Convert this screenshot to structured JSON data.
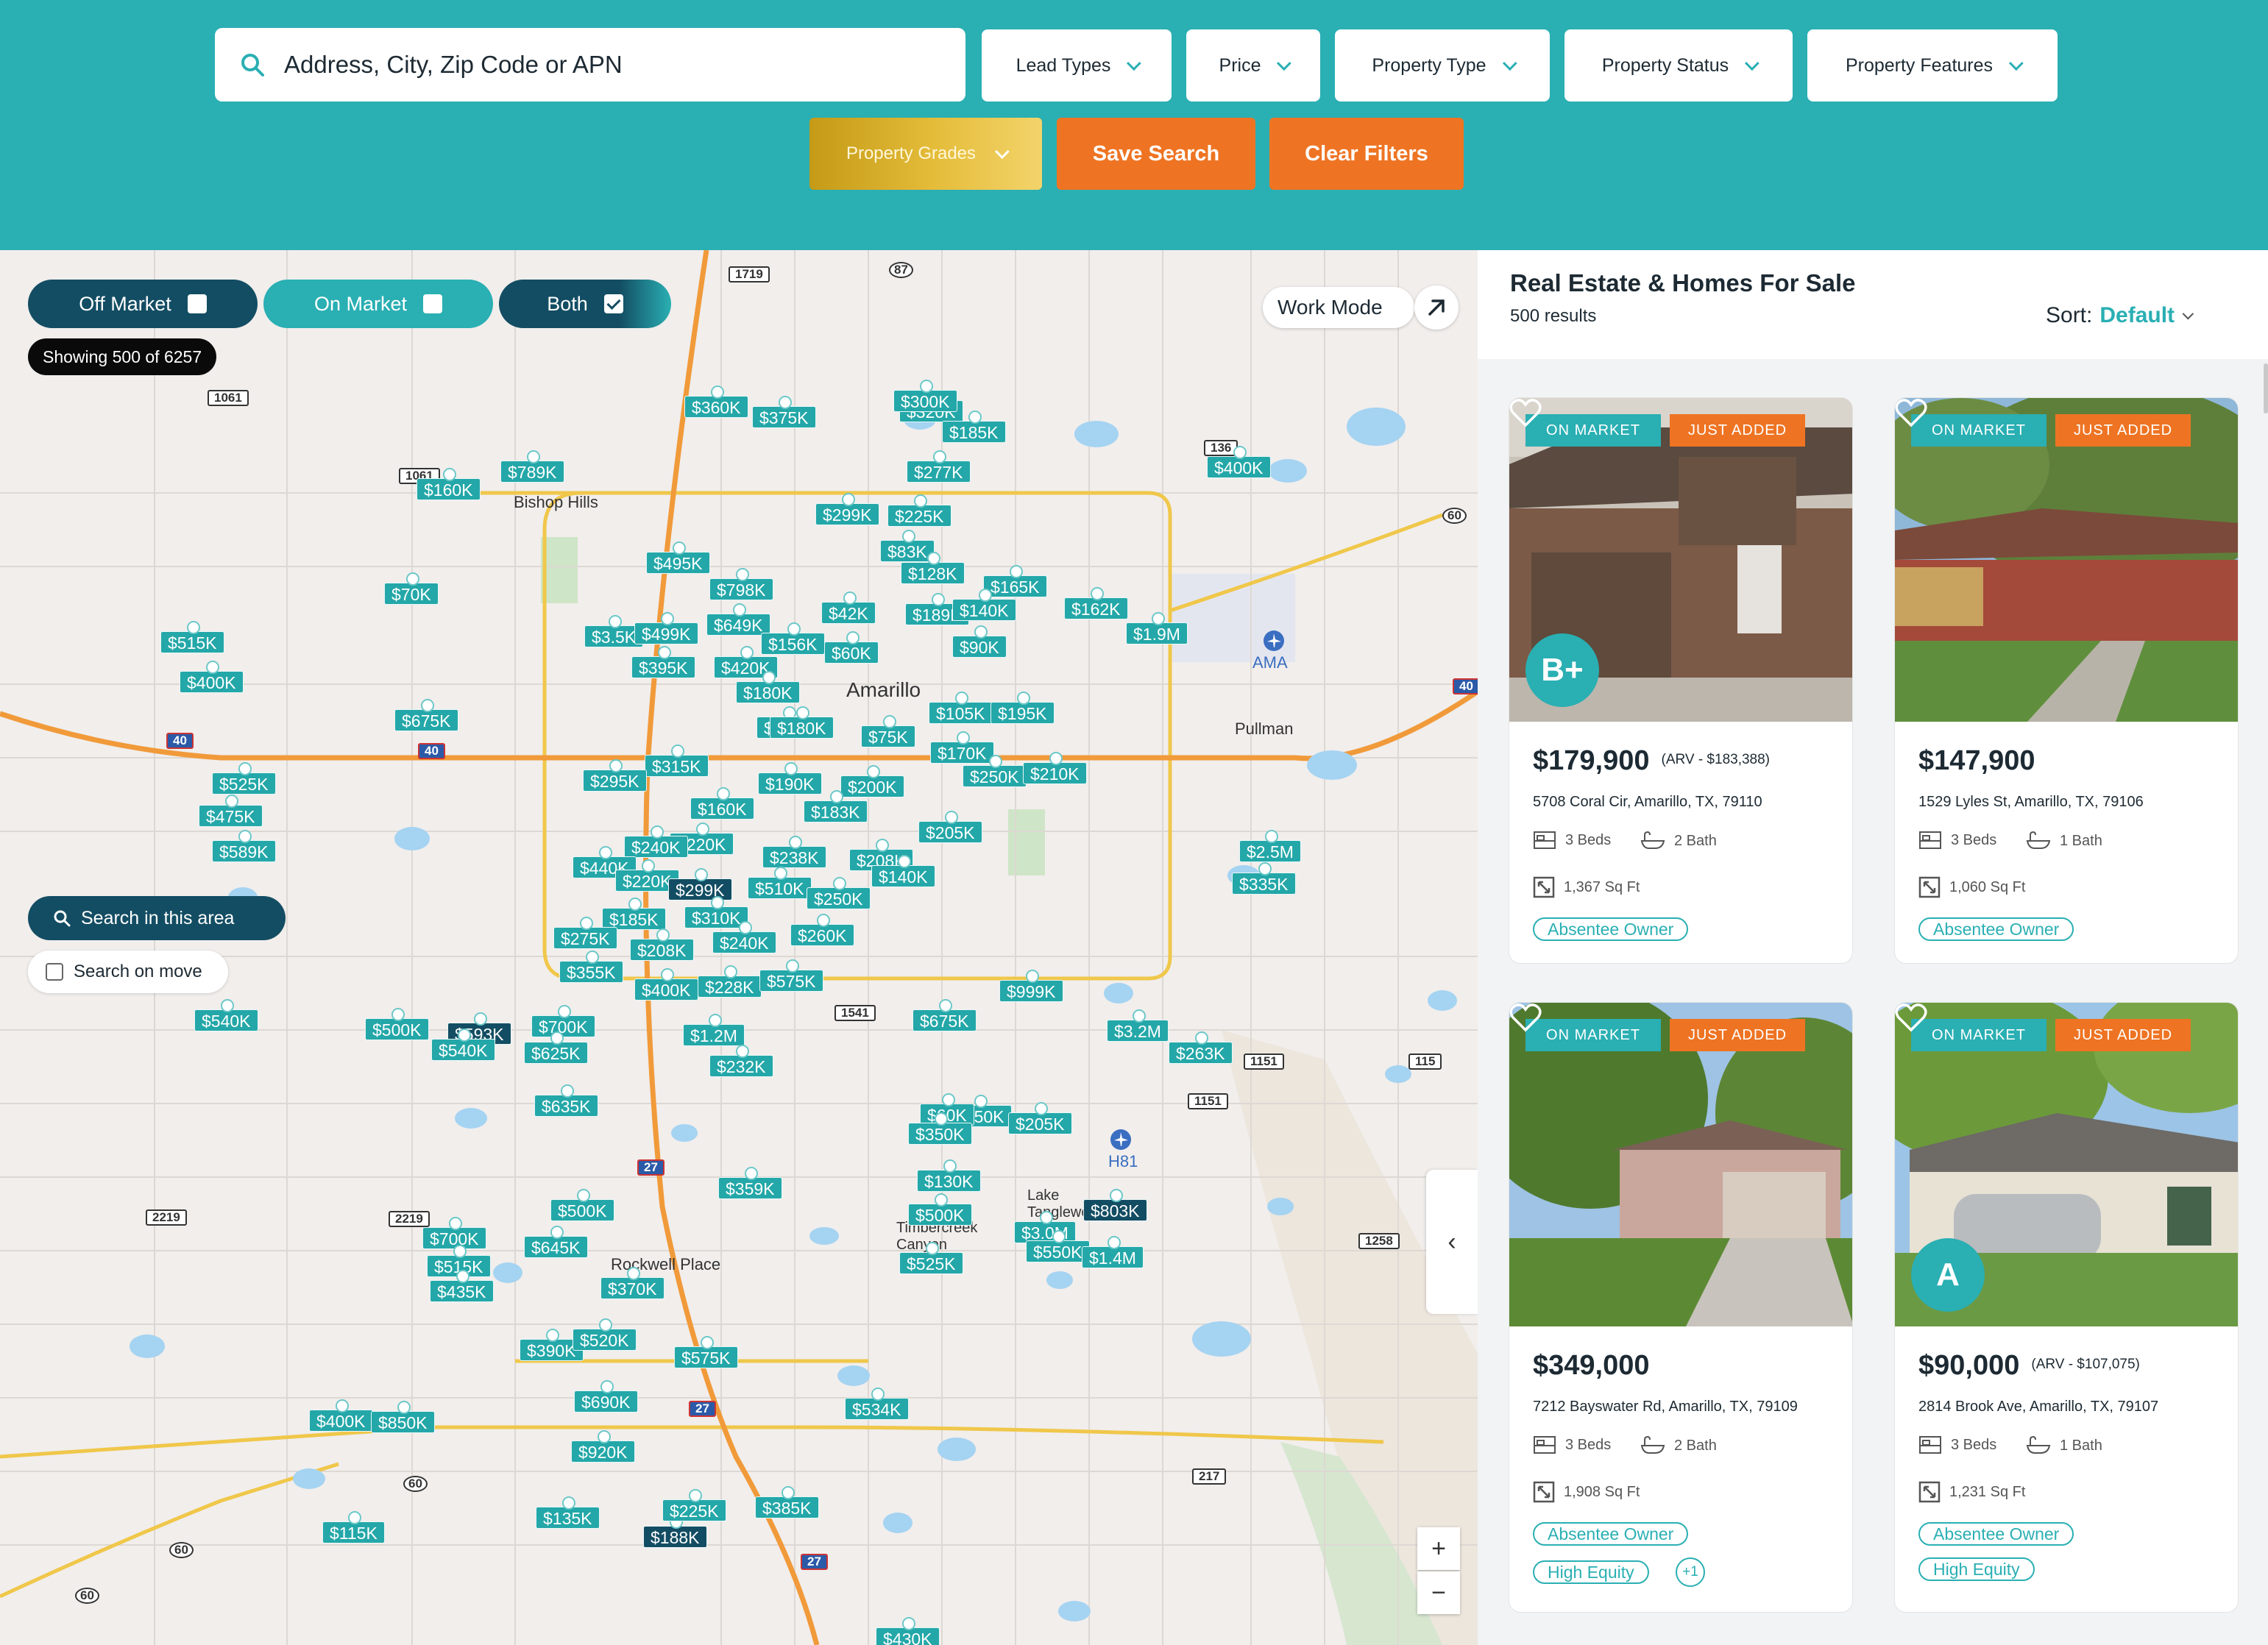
{
  "search": {
    "placeholder": "Address, City, Zip Code or APN"
  },
  "filters": {
    "lead_types": "Lead Types",
    "price": "Price",
    "property_type": "Property Type",
    "property_status": "Property Status",
    "property_features": "Property Features",
    "property_grades": "Property Grades",
    "save_search": "Save Search",
    "clear_filters": "Clear Filters"
  },
  "map": {
    "toggle_off": "Off Market",
    "toggle_on": "On Market",
    "toggle_both": "Both",
    "showing": "Showing 500 of 6257",
    "work_mode": "Work Mode",
    "search_area": "Search in this area",
    "search_move": "Search on move",
    "zoom_in": "+",
    "zoom_out": "−",
    "places": [
      "Bishop Hills",
      "Amarillo",
      "Pullman",
      "AMA",
      "H81",
      "Rockwell Place",
      "Lake Tanglewood",
      "Timbercreek Canyon"
    ],
    "shields": [
      "1719",
      "87",
      "1061",
      "1061",
      "136",
      "60",
      "40",
      "40",
      "40",
      "1541",
      "1151",
      "1151",
      "115",
      "2219",
      "2219",
      "27",
      "1258",
      "27",
      "60",
      "217",
      "60",
      "60",
      "27"
    ],
    "prices": [
      "$360K",
      "$375K",
      "$320K",
      "$185K",
      "$789K",
      "$160K",
      "$277K",
      "$299K",
      "$225K",
      "$400K",
      "$495K",
      "$798K",
      "$83K",
      "$128K",
      "$165K",
      "$70K",
      "$162K",
      "$1.9M",
      "$515K",
      "$400K",
      "$3.5K",
      "$499K",
      "$649K",
      "$42K",
      "$189K",
      "$140K",
      "$395K",
      "$420K",
      "$156K",
      "$60K",
      "$90K",
      "$180K",
      "$105K",
      "$195K",
      "$675K",
      "$184K",
      "$75K",
      "$315K",
      "$295K",
      "$525K",
      "$475K",
      "$170K",
      "$250K",
      "$210K",
      "$190K",
      "$160K",
      "$200K",
      "$183K",
      "$589K",
      "$220K",
      "$240K",
      "$238K",
      "$208K",
      "$205K",
      "$2.5M",
      "$335K",
      "$440K",
      "$220K",
      "$299K",
      "$510K",
      "$140K",
      "$250K",
      "$185K",
      "$310K",
      "$275K",
      "$240K",
      "$260K",
      "$208K",
      "$355K",
      "$228K",
      "$575K",
      "$400K",
      "$540K",
      "$999K",
      "$675K",
      "$500K",
      "$593K",
      "$700K",
      "$540K",
      "$625K",
      "$1.2M",
      "$3.2M",
      "$263K",
      "$232K",
      "$635K",
      "$350K",
      "$205K",
      "$60K",
      "$359K",
      "$130K",
      "$803K",
      "$500K",
      "$3.0M",
      "$550K",
      "$1.4M",
      "$700K",
      "$645K",
      "$515K",
      "$435K",
      "$525K",
      "$370K",
      "$390K",
      "$520K",
      "$575K",
      "$690K",
      "$400K",
      "$850K",
      "$534K",
      "$920K",
      "$115K",
      "$135K",
      "$385K",
      "$188K",
      "$430K",
      "$225K",
      "$350K",
      "$300K",
      "$500K",
      "$180K"
    ]
  },
  "panel": {
    "title": "Real Estate & Homes For Sale",
    "count": "500 results",
    "sort_label": "Sort:",
    "sort_value": "Default"
  },
  "listings": [
    {
      "status": "ON MARKET",
      "flag": "JUST ADDED",
      "grade": "B+",
      "price": "$179,900",
      "arv": "(ARV - $183,388)",
      "address": "5708 Coral Cir, Amarillo, TX, 79110",
      "beds": "3 Beds",
      "baths": "2 Bath",
      "sqft": "1,367 Sq Ft",
      "tags": [
        "Absentee Owner"
      ],
      "more": ""
    },
    {
      "status": "ON MARKET",
      "flag": "JUST ADDED",
      "grade": "",
      "price": "$147,900",
      "arv": "",
      "address": "1529 Lyles St, Amarillo, TX, 79106",
      "beds": "3 Beds",
      "baths": "1 Bath",
      "sqft": "1,060 Sq Ft",
      "tags": [
        "Absentee Owner"
      ],
      "more": ""
    },
    {
      "status": "ON MARKET",
      "flag": "JUST ADDED",
      "grade": "",
      "price": "$349,000",
      "arv": "",
      "address": "7212 Bayswater Rd, Amarillo, TX, 79109",
      "beds": "3 Beds",
      "baths": "2 Bath",
      "sqft": "1,908 Sq Ft",
      "tags": [
        "Absentee Owner",
        "High Equity"
      ],
      "more": "+1"
    },
    {
      "status": "ON MARKET",
      "flag": "JUST ADDED",
      "grade": "A",
      "price": "$90,000",
      "arv": "(ARV - $107,075)",
      "address": "2814 Brook Ave, Amarillo, TX, 79107",
      "beds": "3 Beds",
      "baths": "1 Bath",
      "sqft": "1,231 Sq Ft",
      "tags": [
        "Absentee Owner",
        "High Equity"
      ],
      "more": ""
    }
  ],
  "colors": {
    "teal": "#2aafb3",
    "navy": "#134d63",
    "orange": "#ee7423",
    "gold": "#e5bd3b"
  },
  "icons": [
    "search-icon",
    "chevron-down-icon",
    "checkbox-icon",
    "arrow-up-right-icon",
    "heart-icon",
    "bed-icon",
    "bath-icon",
    "sqft-icon",
    "chevron-left-icon",
    "airport-icon"
  ]
}
